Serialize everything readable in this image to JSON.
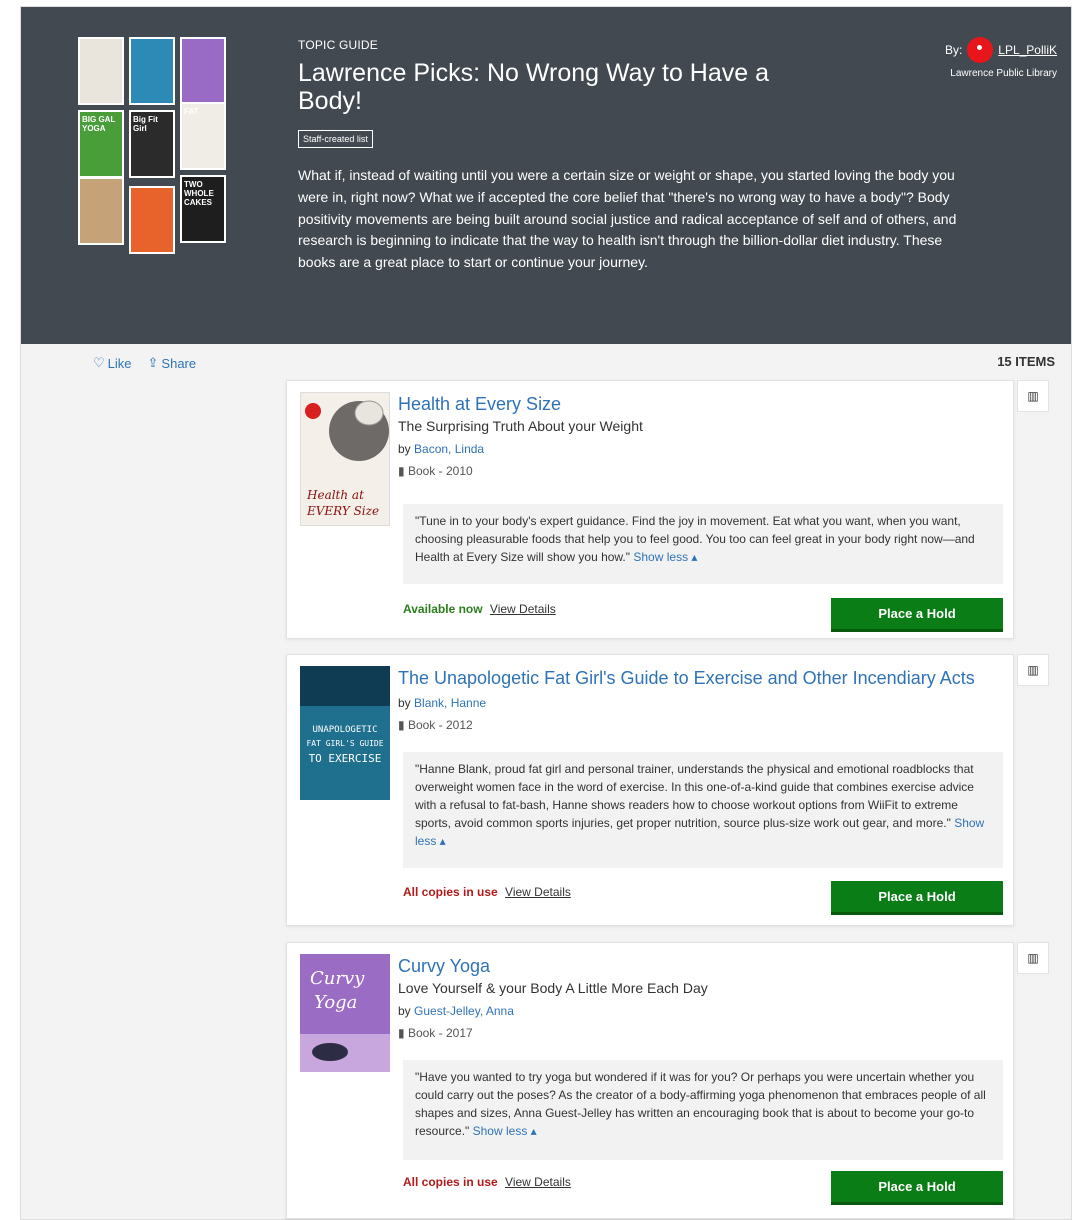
{
  "header": {
    "eyebrow": "TOPIC GUIDE",
    "title": "Lawrence Picks: No Wrong Way to Have a Body!",
    "badge": "Staff-created list",
    "description": "What if, instead of waiting until you were a certain size or weight or shape, you started loving the body you were in, right now? What we if accepted the core belief that \"there's no wrong way to have a body\"? Body positivity movements are being built around social justice and radical acceptance of self and of others, and research is beginning to indicate that the way to health isn't through the billion-dollar diet industry. These books are a great place to start or continue your journey.",
    "by_label": "By:",
    "by_user": "LPL_PolliK",
    "by_org": "Lawrence Public Library"
  },
  "actions": {
    "like": "Like",
    "share": "Share",
    "item_count": "15 ITEMS"
  },
  "cover_thumbs": [
    {
      "text": "",
      "color": "#e9e4dc"
    },
    {
      "text": "",
      "color": "#2d89b5"
    },
    {
      "text": "",
      "color": "#9a6bc4"
    },
    {
      "text": "BIG GAL YOGA",
      "color": "#4a9e3a"
    },
    {
      "text": "Big Fit Girl",
      "color": "#2b2b2b"
    },
    {
      "text": "FAT",
      "color": "#f0ece6"
    },
    {
      "text": "",
      "color": "#c6a278"
    },
    {
      "text": "",
      "color": "#e8622b"
    },
    {
      "text": "TWO WHOLE CAKES",
      "color": "#1e1e1e"
    }
  ],
  "books": [
    {
      "title": "Health at Every Size",
      "subtitle": "The Surprising Truth About your Weight",
      "by": "by",
      "author": "Bacon, Linda",
      "format": "Book - 2010",
      "quote": "\"Tune in to your body's expert guidance. Find the joy in movement. Eat what you want, when you want, choosing pleasurable foods that help you to feel good. You too can feel great in your body right now—and Health at Every Size will show you how.\"",
      "show_less": "Show less",
      "status": "Available now",
      "status_type": "avail",
      "details": "View Details",
      "hold": "Place a Hold",
      "cover_text": "Health at EVERY Size",
      "cover_color": "#f4efe8"
    },
    {
      "title": "The Unapologetic Fat Girl's Guide to Exercise and Other Incendiary Acts",
      "subtitle": "",
      "by": "by",
      "author": "Blank, Hanne",
      "format": "Book - 2012",
      "quote": "\"Hanne Blank, proud fat girl and personal trainer, understands the physical and emotional roadblocks that overweight women face in the word of exercise. In this one-of-a-kind guide that combines exercise advice with a refusal to fat-bash, Hanne shows readers how to choose workout options from WiiFit to extreme sports, avoid common sports injuries, get proper nutrition, source plus-size work out gear, and more.\"",
      "show_less": "Show less",
      "status": "All copies in use",
      "status_type": "inuse",
      "details": "View Details",
      "hold": "Place a Hold",
      "cover_text": "UNAPOLOGETIC FAT GIRL'S GUIDE TO EXERCISE",
      "cover_color": "#1f6f8e"
    },
    {
      "title": "Curvy Yoga",
      "subtitle": "Love Yourself & your Body A Little More Each Day",
      "by": "by",
      "author": "Guest-Jelley, Anna",
      "format": "Book - 2017",
      "quote": "\"Have you wanted to try yoga but wondered if it was for you? Or perhaps you were uncertain whether you could carry out the poses? As the creator of a body-affirming yoga phenomenon that embraces people of all shapes and sizes, Anna Guest-Jelley has written an encouraging book that is about to become your go-to resource.\"",
      "show_less": "Show less",
      "status": "All copies in use",
      "status_type": "inuse",
      "details": "View Details",
      "hold": "Place a Hold",
      "cover_text": "CURVY YOGA",
      "cover_color": "#9b6cc3"
    }
  ]
}
